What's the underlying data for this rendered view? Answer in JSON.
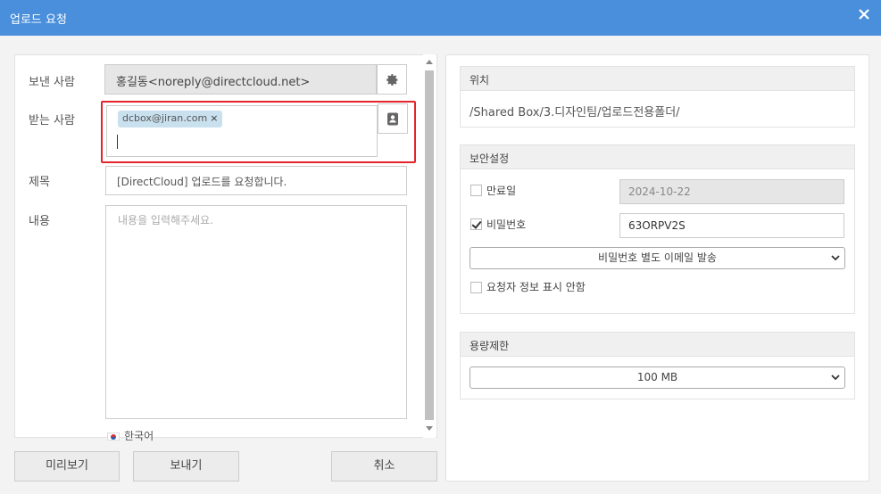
{
  "window": {
    "title": "업로드 요청"
  },
  "form": {
    "sender_label": "보낸 사람",
    "sender_value": "홍길동<noreply@directcloud.net>",
    "recipient_label": "받는 사람",
    "recipients": [
      {
        "email": "dcbox@jiran.com",
        "remove": "×"
      }
    ],
    "subject_label": "제목",
    "subject_value": "[DirectCloud] 업로드를 요청합니다.",
    "content_label": "내용",
    "content_placeholder": "내용을 입력해주세요.",
    "language": "한국어"
  },
  "buttons": {
    "preview": "미리보기",
    "send": "보내기",
    "cancel": "취소"
  },
  "location": {
    "header": "위치",
    "path": "/Shared Box/3.디자인팀/업로드전용폴더/"
  },
  "security": {
    "header": "보안설정",
    "expiry_label": "만료일",
    "expiry_checked": false,
    "expiry_value": "2024-10-22",
    "password_label": "비밀번호",
    "password_checked": true,
    "password_value": "63ORPV2S",
    "password_email_option": "비밀번호 별도 이메일 발송",
    "hide_requester_label": "요청자 정보 표시 안함",
    "hide_requester_checked": false
  },
  "capacity": {
    "header": "용량제한",
    "selected": "100 MB"
  },
  "colors": {
    "titlebar": "#4a8fdb",
    "highlight": "#e4232b",
    "chip": "#c9e1ee"
  }
}
